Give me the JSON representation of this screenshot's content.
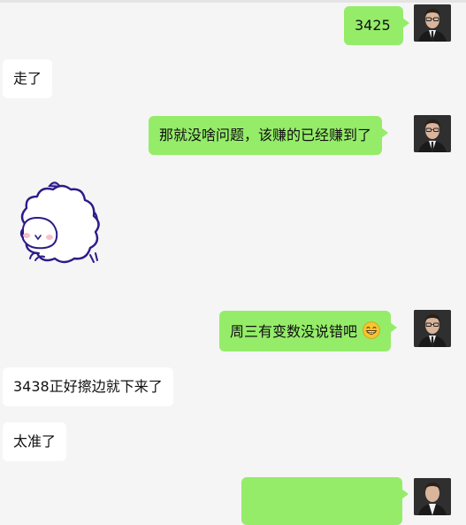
{
  "messages": [
    {
      "side": "out",
      "text": "3425"
    },
    {
      "side": "in",
      "text": "走了"
    },
    {
      "side": "out",
      "text": "那就没啥问题，该赚的已经赚到了"
    },
    {
      "side": "in",
      "type": "sticker",
      "sticker": "sheep-sticker"
    },
    {
      "side": "out",
      "text": "周三有变数没说错吧",
      "emoji": "grinning-face-emoji"
    },
    {
      "side": "in",
      "text": "3438正好擦边就下来了"
    },
    {
      "side": "in",
      "text": "太准了"
    },
    {
      "side": "out",
      "text": ""
    }
  ],
  "colors": {
    "outgoing_bubble": "#95ec69",
    "incoming_bubble": "#ffffff",
    "background": "#f5f5f5"
  }
}
